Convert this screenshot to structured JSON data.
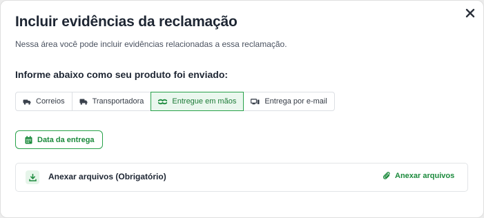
{
  "modal": {
    "title": "Incluir evidências da reclamação",
    "subtitle": "Nessa área você pode incluir evidências relacionadas a essa reclamação.",
    "close_icon": "close-icon"
  },
  "shipping": {
    "heading": "Informe abaixo como seu produto foi enviado:",
    "options": [
      {
        "label": "Correios",
        "icon": "mail-truck-icon",
        "selected": false
      },
      {
        "label": "Transportadora",
        "icon": "truck-icon",
        "selected": false
      },
      {
        "label": "Entregue em mãos",
        "icon": "handshake-icon",
        "selected": true
      },
      {
        "label": "Entrega por e-mail",
        "icon": "email-device-icon",
        "selected": false
      }
    ]
  },
  "date_button": {
    "label": "Data da entrega",
    "icon": "calendar-icon"
  },
  "attachments": {
    "label": "Anexar arquivos (Obrigatório)",
    "action_label": "Anexar arquivos",
    "leading_icon": "download-icon",
    "action_icon": "paperclip-icon"
  },
  "colors": {
    "accent": "#27a149",
    "accent_text": "#1b8a3c",
    "selected_bg": "#eaf7ee",
    "text_dark": "#1e2633"
  }
}
